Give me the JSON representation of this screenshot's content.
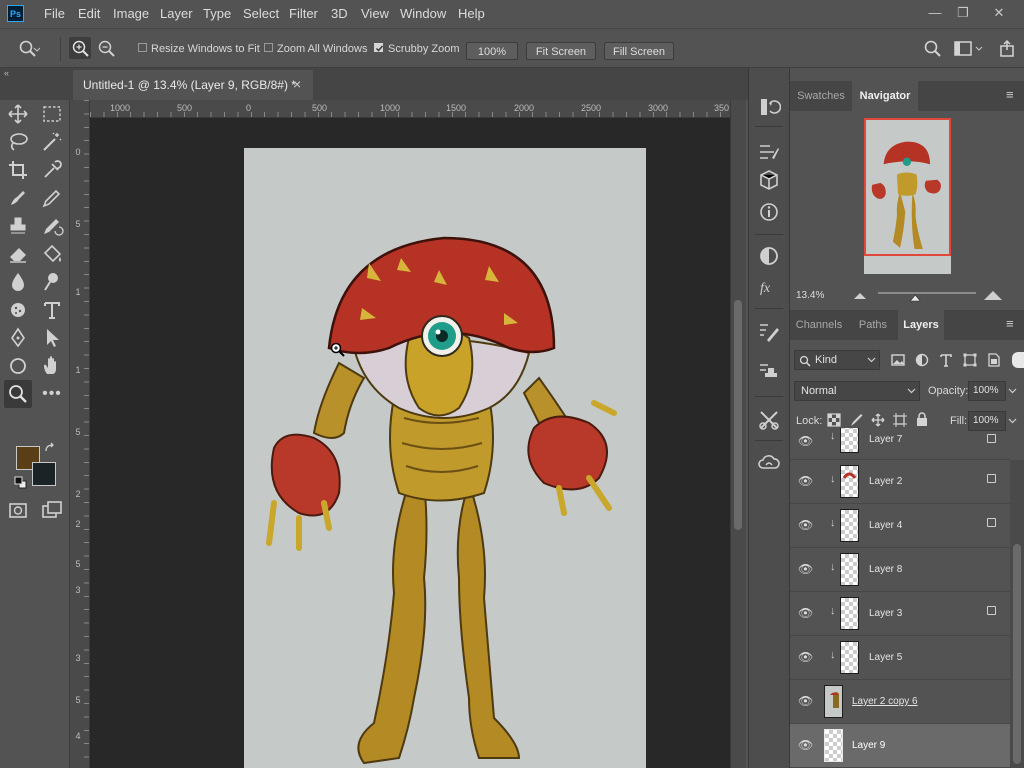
{
  "app": {
    "logo": "Ps"
  },
  "menu": [
    "File",
    "Edit",
    "Image",
    "Layer",
    "Type",
    "Select",
    "Filter",
    "3D",
    "View",
    "Window",
    "Help"
  ],
  "window_controls": {
    "minimize": "—",
    "restore": "❐",
    "close": "✕"
  },
  "options": {
    "resize_windows_label": "Resize Windows to Fit",
    "resize_windows_checked": false,
    "zoom_all_label": "Zoom All Windows",
    "zoom_all_checked": false,
    "scrubby_zoom_label": "Scrubby Zoom",
    "scrubby_zoom_checked": true,
    "zoom_100_label": "100%",
    "fit_screen_label": "Fit Screen",
    "fill_screen_label": "Fill Screen"
  },
  "document_tab": {
    "title": "Untitled-1 @ 13.4% (Layer 9, RGB/8#) *",
    "close": "×"
  },
  "rulers": {
    "top": [
      "1000",
      "500",
      "0",
      "500",
      "1000",
      "1500",
      "2000",
      "2500",
      "3000",
      "350"
    ],
    "left": [
      "0",
      "5",
      "1",
      "1",
      "5",
      "2",
      "2",
      "5",
      "3",
      "3",
      "5",
      "4"
    ]
  },
  "swatches": {
    "foreground": "#5a3f16",
    "background": "#1a2326"
  },
  "navigator": {
    "tabs": [
      "Swatches",
      "Navigator"
    ],
    "active_tab": "Navigator",
    "zoom": "13.4%",
    "zoom_fraction": 0.38
  },
  "layers_panel": {
    "tabs": [
      "Channels",
      "Paths",
      "Layers"
    ],
    "active_tab": "Layers",
    "filter_kind": "Kind",
    "blend_mode": "Normal",
    "opacity_label": "Opacity:",
    "opacity": "100%",
    "lock_label": "Lock:",
    "fill_label": "Fill:",
    "fill": "100%",
    "layers": [
      {
        "name": "Layer 7",
        "clipped": true,
        "locked": true,
        "selected": false,
        "partial": true
      },
      {
        "name": "Layer 2",
        "clipped": true,
        "locked": true,
        "selected": false
      },
      {
        "name": "Layer 4",
        "clipped": true,
        "locked": true,
        "selected": false
      },
      {
        "name": "Layer 8",
        "clipped": true,
        "locked": false,
        "selected": false
      },
      {
        "name": "Layer 3",
        "clipped": true,
        "locked": true,
        "selected": false
      },
      {
        "name": "Layer 5",
        "clipped": true,
        "locked": false,
        "selected": false
      },
      {
        "name": "Layer 2 copy 6",
        "clipped": false,
        "locked": false,
        "selected": false
      },
      {
        "name": "Layer 9",
        "clipped": false,
        "locked": false,
        "selected": true
      }
    ]
  }
}
